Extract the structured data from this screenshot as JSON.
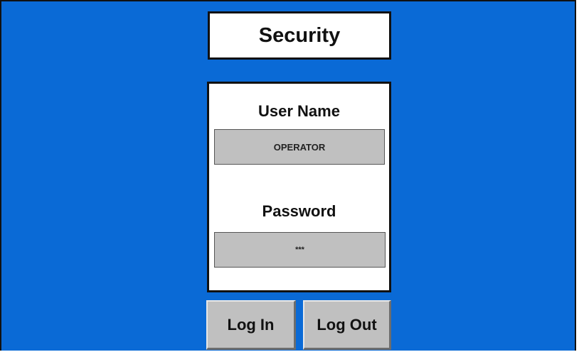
{
  "screen": {
    "title": "Security",
    "background_color": "#0a6ad6"
  },
  "login_panel": {
    "user_name_label": "User Name",
    "user_name_value": "OPERATOR",
    "password_label": "Password",
    "password_value": "***"
  },
  "buttons": {
    "log_in": "Log In",
    "log_out": "Log Out"
  }
}
